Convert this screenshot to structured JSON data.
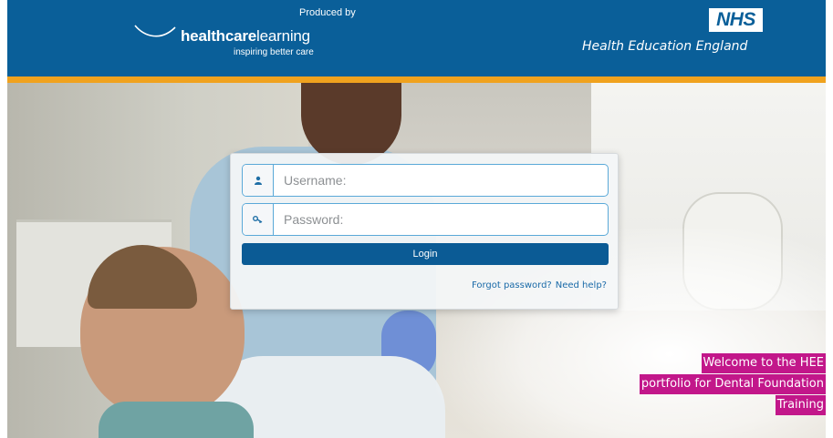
{
  "header": {
    "produced_by": "Produced by",
    "logo_bold": "healthcare",
    "logo_regular": "learning",
    "tagline": "inspiring better care",
    "nhs_badge": "NHS",
    "org_name": "Health Education England"
  },
  "login": {
    "username_placeholder": "Username:",
    "password_placeholder": "Password:",
    "login_label": "Login",
    "forgot_password": "Forgot password?",
    "need_help": "Need help?"
  },
  "welcome": {
    "line1": "Welcome to the HEE",
    "line2": "portfolio for Dental Foundation",
    "line3": "Training"
  },
  "icons": {
    "username": "user-icon",
    "password": "key-icon",
    "logo_swoosh": "swoosh-icon"
  },
  "colors": {
    "header_blue": "#0a5f99",
    "accent_orange": "#f0a21e",
    "button_blue": "#0b5b95",
    "link_blue": "#1a6aa8",
    "welcome_magenta": "#c2178a"
  }
}
